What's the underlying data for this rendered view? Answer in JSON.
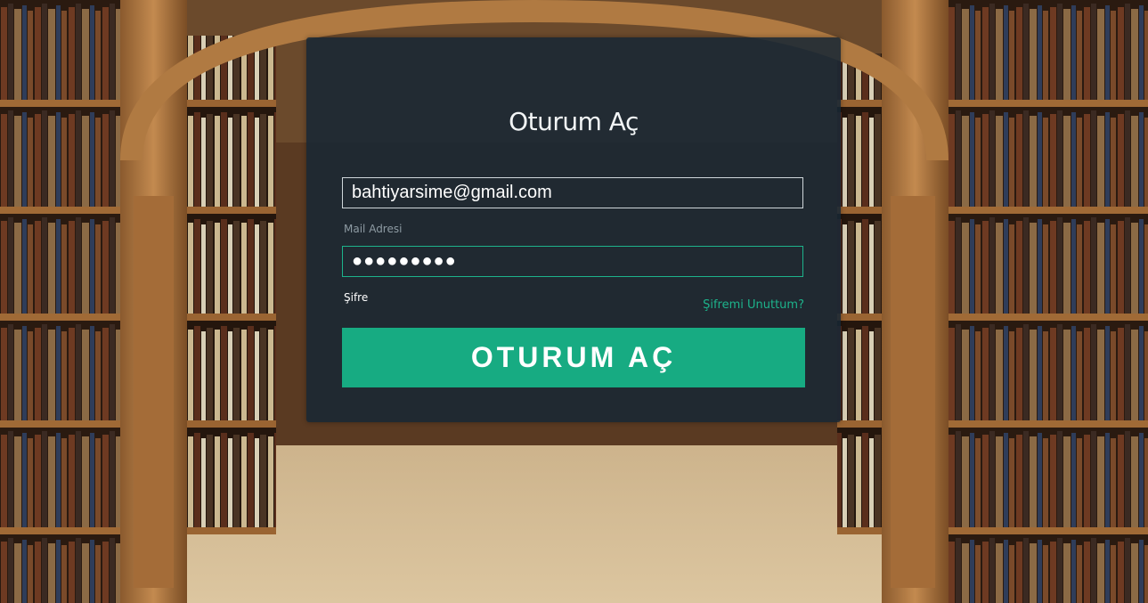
{
  "login": {
    "title": "Oturum Aç",
    "email_value": "bahtiyarsime@gmail.com",
    "email_label": "Mail Adresi",
    "password_mask": "●●●●●●●●●",
    "password_label": "Şifre",
    "forgot_link": "Şifremi Unuttum?",
    "submit_label": "OTURUM AÇ"
  },
  "colors": {
    "accent": "#17ab82",
    "panel": "#162634"
  }
}
